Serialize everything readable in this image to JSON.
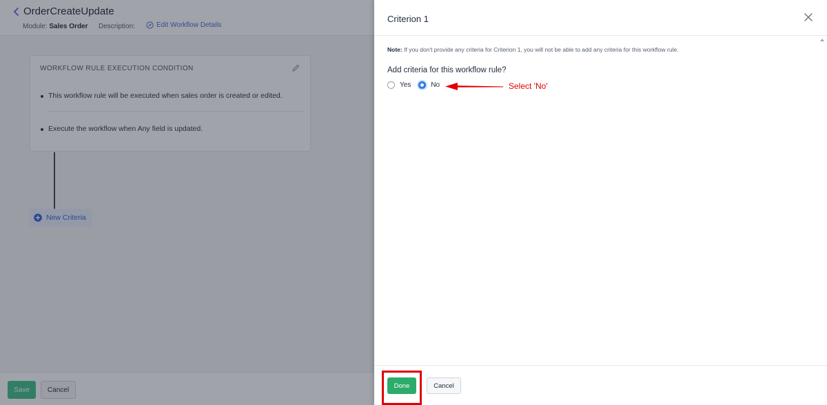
{
  "background": {
    "page_title": "OrderCreateUpdate",
    "module_label": "Module:",
    "module_value": "Sales Order",
    "description_label": "Description:",
    "edit_link": "Edit Workflow Details",
    "condition": {
      "title": "WORKFLOW RULE EXECUTION CONDITION",
      "items": [
        "This workflow rule will be executed when sales order is created or edited.",
        "Execute the workflow when Any field is updated."
      ]
    },
    "new_criteria": "New Criteria",
    "save_label": "Save",
    "cancel_label": "Cancel"
  },
  "panel": {
    "title": "Criterion 1",
    "note_label": "Note:",
    "note_text": "If you don't provide any criteria for Criterion 1, you will not be able to add any criteria for this workflow rule.",
    "question": "Add criteria for this workflow rule?",
    "options": [
      {
        "label": "Yes",
        "selected": false
      },
      {
        "label": "No",
        "selected": true
      }
    ],
    "done_label": "Done",
    "cancel_label": "Cancel"
  },
  "annotation": {
    "text": "Select 'No'",
    "color": "#e00000"
  },
  "colors": {
    "accent": "#2f7be6",
    "done": "#2dab6b",
    "overlay": "rgba(30,36,52,0.42)"
  }
}
